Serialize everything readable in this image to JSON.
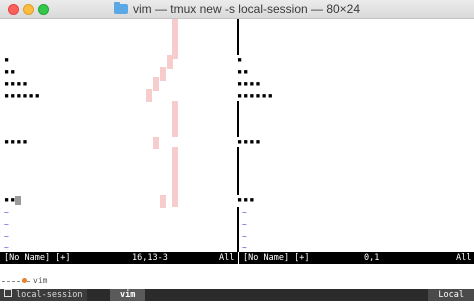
{
  "window": {
    "title": "vim — tmux new -s local-session — 80×24"
  },
  "editor": {
    "left_pane": {
      "lines": [
        "▪",
        "▪▪",
        "▪▪▪▪",
        "▪▪▪▪▪▪",
        "▪▪▪▪",
        "▪▪▪"
      ],
      "status_name": "[No Name] [+]",
      "status_pos": "16,13-3",
      "status_scroll": "All"
    },
    "right_pane": {
      "lines": [
        "▪",
        "▪▪",
        "▪▪▪▪",
        "▪▪▪▪▪▪",
        "▪▪▪▪",
        "▪▪▪"
      ],
      "status_name": "[No Name] [+]",
      "status_pos": "0,1",
      "status_scroll": "All"
    },
    "tilde": "~"
  },
  "tmux": {
    "cmd_label": "vim",
    "session_name": "local-session",
    "window_tab": "vim",
    "host_label": "Local"
  },
  "colors": {
    "status_bg": "#000000",
    "highlight_pink": "#f6cccc",
    "tilde_blue": "#4a4ad8",
    "tmux_bg": "#2b2b2b"
  }
}
